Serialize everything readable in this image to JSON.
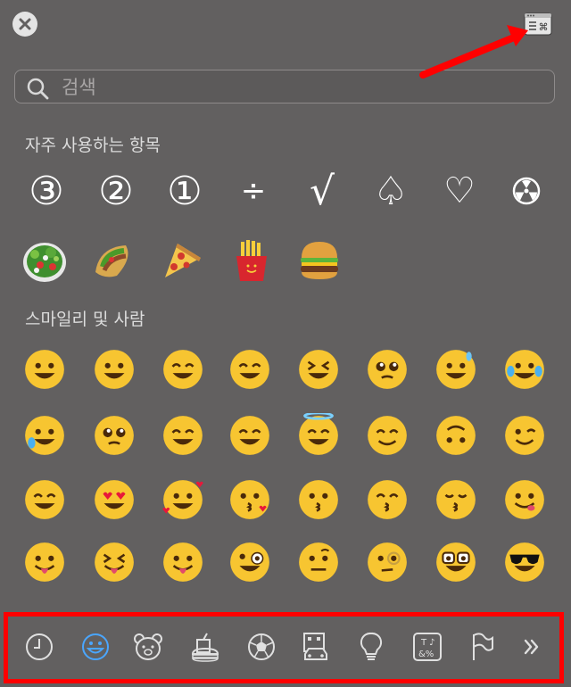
{
  "close_button": {
    "icon": "close-icon"
  },
  "viewer_button": {
    "icon": "character-viewer-icon",
    "glyph": "⌘"
  },
  "search": {
    "placeholder": "검색",
    "value": ""
  },
  "frequently_used": {
    "title": "자주 사용하는 항목",
    "symbols": [
      "③",
      "②",
      "①",
      "÷",
      "√",
      "♤",
      "♡"
    ],
    "extra_icon": "radioactive-icon",
    "food": [
      "green-salad-icon",
      "stuffed-flatbread-icon",
      "pizza-icon",
      "french-fries-icon",
      "hamburger-icon"
    ]
  },
  "smileys": {
    "title": "스마일리 및 사람",
    "rows": [
      [
        "grinning-face-icon",
        "grinning-face-big-eyes-icon",
        "grinning-face-smiling-eyes-icon",
        "beaming-face-icon",
        "squinting-face-icon",
        "pleading-face-icon",
        "grinning-sweat-face-icon",
        "tears-of-joy-face-icon"
      ],
      [
        "rofl-face-icon",
        "face-holding-back-tears-icon",
        "smiling-face-icon",
        "smiling-face-smiling-eyes-icon",
        "halo-face-icon",
        "slightly-smiling-face-icon",
        "upside-down-face-icon",
        "winking-face-icon"
      ],
      [
        "relieved-face-icon",
        "heart-eyes-face-icon",
        "smiling-face-hearts-icon",
        "face-blowing-kiss-icon",
        "kissing-face-icon",
        "kissing-face-smiling-eyes-icon",
        "kissing-face-closed-eyes-icon",
        "face-savoring-food-icon"
      ],
      [
        "face-tongue-icon",
        "squinting-tongue-face-icon",
        "winking-tongue-face-icon",
        "zany-face-icon",
        "raised-eyebrow-face-icon",
        "monocle-face-icon",
        "nerd-face-icon",
        "sunglasses-face-icon"
      ]
    ]
  },
  "category_bar": {
    "items": [
      "clock-icon",
      "smiley-icon",
      "bear-icon",
      "food-icon",
      "soccer-ball-icon",
      "building-car-icon",
      "lightbulb-icon",
      "symbols-icon",
      "flag-icon",
      "chevrons-right-icon"
    ],
    "selected": "smiley-icon"
  },
  "colors": {
    "panel": "#626060",
    "accent": "#4aa6ff",
    "highlight": "#ff0000"
  }
}
